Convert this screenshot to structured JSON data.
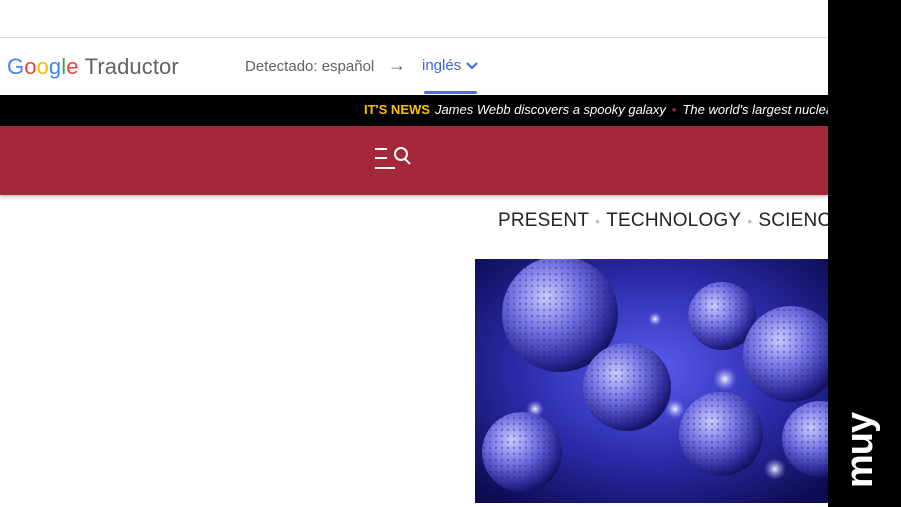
{
  "translate_bar": {
    "brand_letters": [
      {
        "ch": "G",
        "color": "#4285F4"
      },
      {
        "ch": "o",
        "color": "#EA4335"
      },
      {
        "ch": "o",
        "color": "#FBBC05"
      },
      {
        "ch": "g",
        "color": "#4285F4"
      },
      {
        "ch": "l",
        "color": "#34A853"
      },
      {
        "ch": "e",
        "color": "#EA4335"
      }
    ],
    "product": "Traductor",
    "detected": "Detectado: español",
    "arrow": "→",
    "target_language": "inglés"
  },
  "ticker": {
    "label": "IT'S NEWS",
    "item_1": "James Webb discovers a spooky galaxy",
    "separator": "•",
    "item_2": "The world's largest nuclear"
  },
  "header": {
    "menu_search_icon": "menu-search-icon",
    "bar_color": "#a4283a"
  },
  "categories": {
    "item_1": "PRESENT",
    "item_2": "TECHNOLOGY",
    "item_3": "SCIENCE",
    "separator": "•"
  },
  "side_logo": {
    "text": "muy interesante"
  },
  "colors": {
    "accent_blue": "#3c64e0",
    "ticker_label": "#f5c400"
  }
}
